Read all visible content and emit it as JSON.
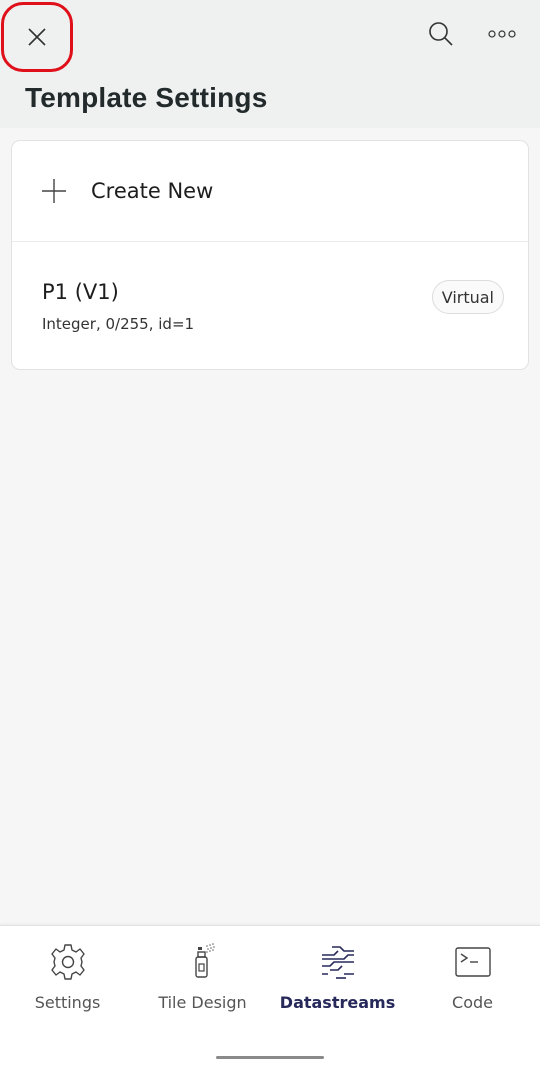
{
  "header": {
    "title": "Template Settings",
    "close_icon": "close-icon",
    "search_icon": "search-icon",
    "more_icon": "more-horizontal-icon",
    "highlight_color": "#e0101a"
  },
  "datastreams": {
    "create_label": "Create New",
    "items": [
      {
        "name": "P1 (V1)",
        "meta": "Integer, 0/255, id=1",
        "badge": "Virtual"
      }
    ]
  },
  "tabbar": {
    "tabs": [
      {
        "label": "Settings",
        "icon": "gear-icon",
        "active": false
      },
      {
        "label": "Tile Design",
        "icon": "spray-can-icon",
        "active": false
      },
      {
        "label": "Datastreams",
        "icon": "datastreams-icon",
        "active": true
      },
      {
        "label": "Code",
        "icon": "terminal-icon",
        "active": false
      }
    ],
    "active_color": "#27295a"
  }
}
